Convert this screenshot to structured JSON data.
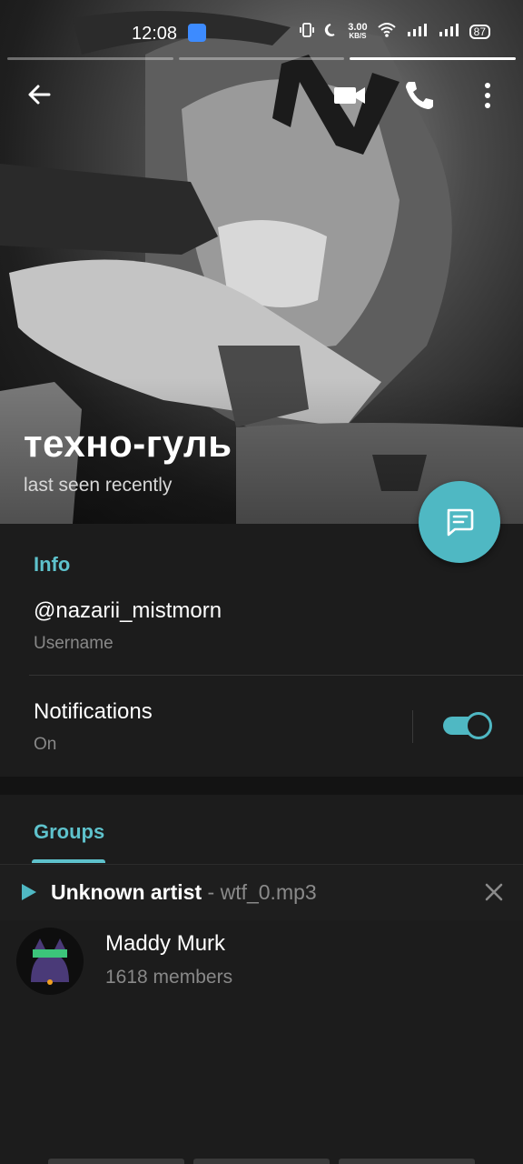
{
  "status_bar": {
    "time": "12:08",
    "speed_value": "3.00",
    "speed_unit": "KB/S",
    "battery": "87"
  },
  "header": {
    "name": "техно-гуль",
    "status": "last seen recently",
    "back_icon": "arrow-left-icon",
    "video_icon": "video-camera-icon",
    "call_icon": "phone-icon",
    "more_icon": "more-vertical-icon",
    "message_icon": "message-icon"
  },
  "info": {
    "title": "Info",
    "username_value": "@nazarii_mistmorn",
    "username_label": "Username",
    "notifications_title": "Notifications",
    "notifications_value": "On",
    "notifications_enabled": true
  },
  "groups_tab": {
    "label": "Groups"
  },
  "player": {
    "artist": "Unknown artist",
    "separator": " - ",
    "track": "wtf_0.mp3"
  },
  "groups": [
    {
      "name": "Maddy Murk",
      "members": "1618 members"
    }
  ],
  "colors": {
    "accent": "#4fb8c3",
    "background": "#1c1c1c"
  }
}
